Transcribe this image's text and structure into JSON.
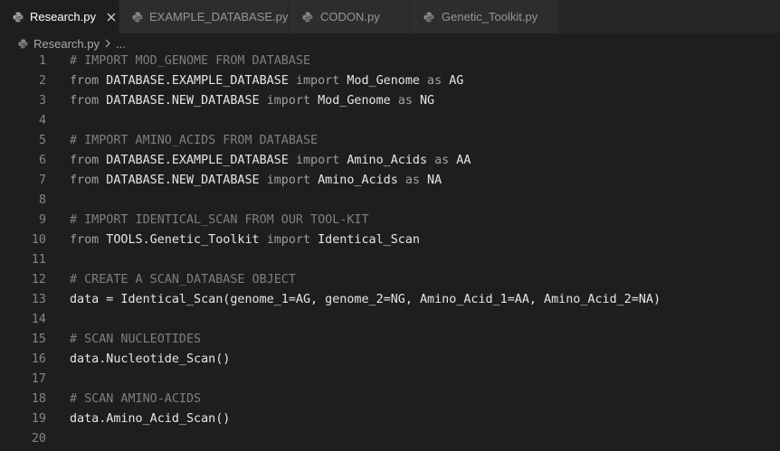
{
  "tabs": [
    {
      "label": "Research.py",
      "active": true
    },
    {
      "label": "EXAMPLE_DATABASE.py",
      "active": false
    },
    {
      "label": "CODON.py",
      "active": false
    },
    {
      "label": "Genetic_Toolkit.py",
      "active": false
    }
  ],
  "breadcrumb": {
    "file": "Research.py",
    "rest": "..."
  },
  "colors": {
    "background": "#1e1e1e",
    "tabbar": "#252526",
    "inactive_tab": "#2d2d2d",
    "comment": "#7f7f7f",
    "keyword": "#a0a0a0",
    "identifier": "#e6e6e6",
    "line_number": "#858585"
  },
  "editor": {
    "lines": [
      {
        "num": "1",
        "tokens": [
          {
            "t": "# IMPORT MOD_GENOME FROM DATABASE",
            "c": "comment"
          }
        ]
      },
      {
        "num": "2",
        "tokens": [
          {
            "t": "from",
            "c": "kw"
          },
          {
            "t": " DATABASE.EXAMPLE_DATABASE ",
            "c": "id"
          },
          {
            "t": "import",
            "c": "kw"
          },
          {
            "t": " Mod_Genome ",
            "c": "id"
          },
          {
            "t": "as",
            "c": "kw"
          },
          {
            "t": " AG",
            "c": "id"
          }
        ]
      },
      {
        "num": "3",
        "tokens": [
          {
            "t": "from",
            "c": "kw"
          },
          {
            "t": " DATABASE.NEW_DATABASE ",
            "c": "id"
          },
          {
            "t": "import",
            "c": "kw"
          },
          {
            "t": " Mod_Genome ",
            "c": "id"
          },
          {
            "t": "as",
            "c": "kw"
          },
          {
            "t": " NG",
            "c": "id"
          }
        ]
      },
      {
        "num": "4",
        "tokens": []
      },
      {
        "num": "5",
        "tokens": [
          {
            "t": "# IMPORT AMINO_ACIDS FROM DATABASE",
            "c": "comment"
          }
        ]
      },
      {
        "num": "6",
        "tokens": [
          {
            "t": "from",
            "c": "kw"
          },
          {
            "t": " DATABASE.EXAMPLE_DATABASE ",
            "c": "id"
          },
          {
            "t": "import",
            "c": "kw"
          },
          {
            "t": " Amino_Acids ",
            "c": "id"
          },
          {
            "t": "as",
            "c": "kw"
          },
          {
            "t": " AA",
            "c": "id"
          }
        ]
      },
      {
        "num": "7",
        "tokens": [
          {
            "t": "from",
            "c": "kw"
          },
          {
            "t": " DATABASE.NEW_DATABASE ",
            "c": "id"
          },
          {
            "t": "import",
            "c": "kw"
          },
          {
            "t": " Amino_Acids ",
            "c": "id"
          },
          {
            "t": "as",
            "c": "kw"
          },
          {
            "t": " NA",
            "c": "id"
          }
        ]
      },
      {
        "num": "8",
        "tokens": []
      },
      {
        "num": "9",
        "tokens": [
          {
            "t": "# IMPORT IDENTICAL_SCAN FROM OUR TOOL-KIT",
            "c": "comment"
          }
        ]
      },
      {
        "num": "10",
        "tokens": [
          {
            "t": "from",
            "c": "kw"
          },
          {
            "t": " TOOLS.Genetic_Toolkit ",
            "c": "id"
          },
          {
            "t": "import",
            "c": "kw"
          },
          {
            "t": " Identical_Scan",
            "c": "id"
          }
        ]
      },
      {
        "num": "11",
        "tokens": []
      },
      {
        "num": "12",
        "tokens": [
          {
            "t": "# CREATE A SCAN_DATABASE OBJECT",
            "c": "comment"
          }
        ]
      },
      {
        "num": "13",
        "tokens": [
          {
            "t": "data = Identical_Scan(genome_1=AG, genome_2=NG, Amino_Acid_1=AA, Amino_Acid_2=NA)",
            "c": "id"
          }
        ]
      },
      {
        "num": "14",
        "tokens": []
      },
      {
        "num": "15",
        "tokens": [
          {
            "t": "# SCAN NUCLEOTIDES",
            "c": "comment"
          }
        ]
      },
      {
        "num": "16",
        "tokens": [
          {
            "t": "data.Nucleotide_Scan()",
            "c": "id"
          }
        ]
      },
      {
        "num": "17",
        "tokens": []
      },
      {
        "num": "18",
        "tokens": [
          {
            "t": "# SCAN AMINO-ACIDS",
            "c": "comment"
          }
        ]
      },
      {
        "num": "19",
        "tokens": [
          {
            "t": "data.Amino_Acid_Scan()",
            "c": "id"
          }
        ]
      },
      {
        "num": "20",
        "tokens": []
      }
    ]
  },
  "icons": {
    "file": "python-file-icon",
    "close": "close-icon",
    "chevron": "chevron-right-icon"
  }
}
